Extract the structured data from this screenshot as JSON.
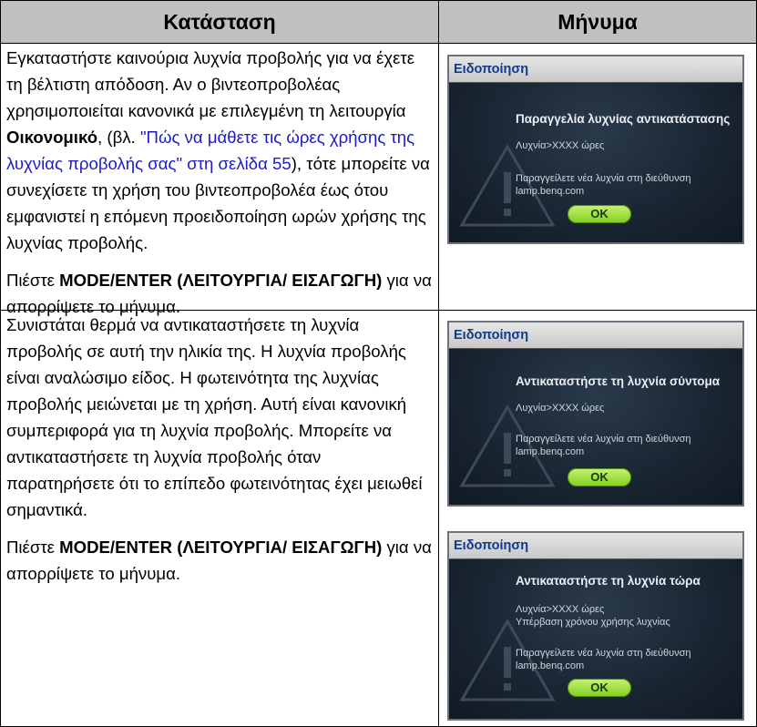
{
  "table": {
    "header": {
      "col1": "Κατάσταση",
      "col2": "Μήνυμα"
    },
    "row1": {
      "p1_a": "Εγκαταστήστε καινούρια λυχνία προβολής για να έχετε τη βέλτιστη απόδοση. Αν ο βιντεοπροβολέας χρησιμοποιείται κανονικά με επιλεγμένη τη λειτουργία ",
      "p1_bold": "Οικονομικό",
      "p1_b": ", (βλ. ",
      "p1_link": "\"Πώς να μάθετε τις ώρες χρήσης της λυχνίας προβολής σας\" στη σελίδα 55",
      "p1_c": "), τότε μπορείτε να συνεχίσετε τη χρήση του βιντεοπροβολέα έως ότου εμφανιστεί η επόμενη προειδοποίηση ωρών χρήσης της λυχνίας προβολής.",
      "p2_a": "Πιέστε ",
      "p2_bold": "MODE/ENTER (ΛΕΙΤΟΥΡΓΙΑ/ ΕΙΣΑΓΩΓΗ)",
      "p2_b": " για να απορρίψετε το μήνυμα."
    },
    "row2": {
      "p1": "Συνιστάται θερμά να αντικαταστήσετε τη λυχνία προβολής σε αυτή την ηλικία της. Η λυχνία προβολής είναι αναλώσιμο είδος. Η φωτεινότητα της λυχνίας προβολής μειώνεται με τη χρήση. Αυτή είναι κανονική συμπεριφορά για τη λυχνία προβολής. Μπορείτε να αντικαταστήσετε τη λυχνία προβολής όταν παρατηρήσετε ότι το επίπεδο φωτεινότητας έχει μειωθεί σημαντικά.",
      "p2_a": "Πιέστε ",
      "p2_bold": "MODE/ENTER (ΛΕΙΤΟΥΡΓΙΑ/ ΕΙΣΑΓΩΓΗ)",
      "p2_b": " για να απορρίψετε το μήνυμα."
    }
  },
  "osd1": {
    "title": "Ειδοποίηση",
    "heading": "Παραγγελία λυχνίας αντικατάστασης",
    "line1": "Λυχνία>XXXX ώρες",
    "line2": "Παραγγείλετε νέα λυχνία στη διεύθυνση",
    "line3": "lamp.benq.com",
    "ok": "OK"
  },
  "osd2": {
    "title": "Ειδοποίηση",
    "heading": "Αντικαταστήστε τη λυχνία σύντομα",
    "line1": "Λυχνία>XXXX ώρες",
    "line2": "Παραγγείλετε νέα λυχνία στη διεύθυνση",
    "line3": "lamp.benq.com",
    "ok": "OK"
  },
  "osd3": {
    "title": "Ειδοποίηση",
    "heading": "Αντικαταστήστε τη λυχνία τώρα",
    "line1": "Λυχνία>XXXX ώρες",
    "line1b": "Υπέρβαση χρόνου χρήσης λυχνίας",
    "line2": "Παραγγείλετε νέα λυχνία στη διεύθυνση",
    "line3": "lamp.benq.com",
    "ok": "OK"
  },
  "colors": {
    "header_bg": "#c0c0c0",
    "link": "#1a1acf",
    "osd_bg": "#1a2633",
    "ok_button": "#9be03a"
  }
}
